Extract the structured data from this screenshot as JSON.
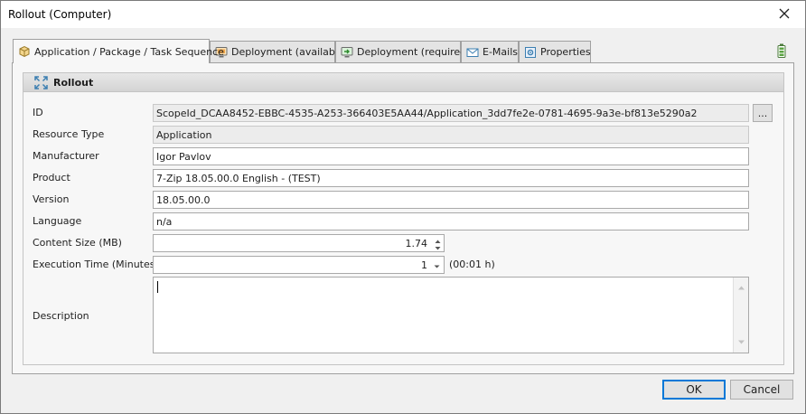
{
  "window": {
    "title": "Rollout (Computer)"
  },
  "tabs": [
    {
      "label": "Application / Package / Task Sequence",
      "icon": "package-icon"
    },
    {
      "label": "Deployment (available)",
      "icon": "computer-icon"
    },
    {
      "label": "Deployment (required)",
      "icon": "computer-arrow-icon"
    },
    {
      "label": "E-Mails",
      "icon": "envelope-icon"
    },
    {
      "label": "Properties",
      "icon": "properties-icon"
    }
  ],
  "group": {
    "title": "Rollout"
  },
  "fields": {
    "id": {
      "label": "ID",
      "value": "ScopeId_DCAA8452-EBBC-4535-A253-366403E5AA44/Application_3dd7fe2e-0781-4695-9a3e-bf813e5290a2",
      "browse_label": "..."
    },
    "resource_type": {
      "label": "Resource Type",
      "value": "Application"
    },
    "manufacturer": {
      "label": "Manufacturer",
      "value": "Igor Pavlov"
    },
    "product": {
      "label": "Product",
      "value": "7-Zip 18.05.00.0 English - (TEST)"
    },
    "version": {
      "label": "Version",
      "value": "18.05.00.0"
    },
    "language": {
      "label": "Language",
      "value": "n/a"
    },
    "content_size": {
      "label": "Content Size (MB)",
      "value": "1.74"
    },
    "execution_time": {
      "label": "Execution Time (Minutes)",
      "value": "1",
      "hint": "(00:01 h)"
    },
    "description": {
      "label": "Description",
      "value": ""
    }
  },
  "buttons": {
    "ok": "OK",
    "cancel": "Cancel"
  },
  "colors": {
    "accent": "#3c7fb1",
    "ok_border": "#0078d7"
  }
}
